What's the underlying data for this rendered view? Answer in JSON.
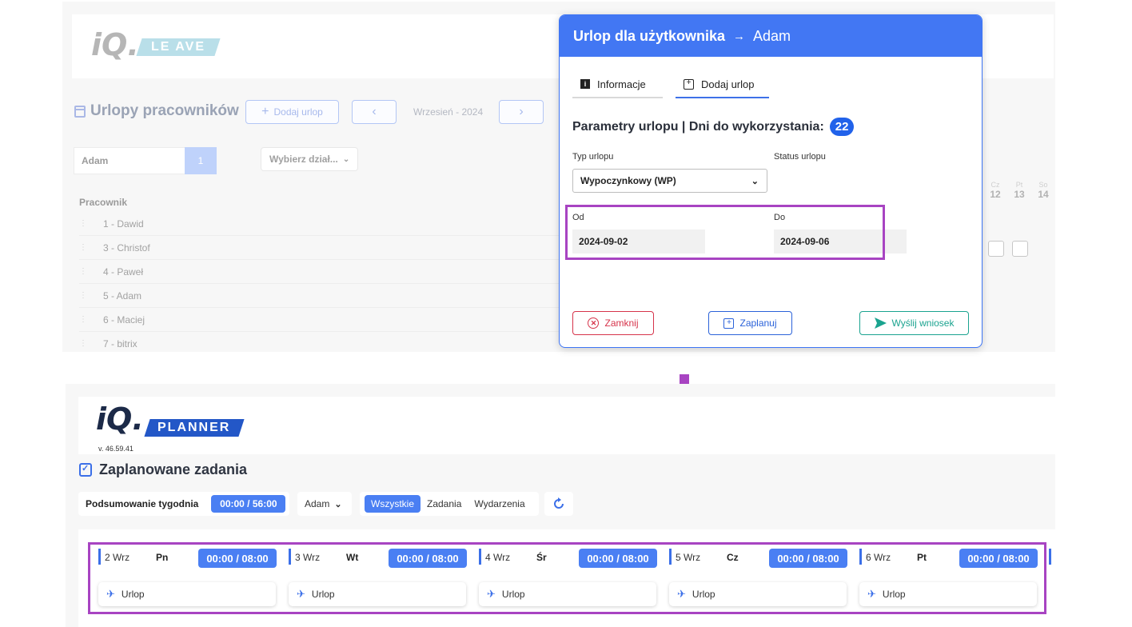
{
  "leave_app": {
    "logo": {
      "iq": "iQ.",
      "tag": "LE AVE"
    },
    "title": "Urlopy pracowników",
    "add_button": "Dodaj urlop",
    "prev_button": "‹",
    "next_button": "›",
    "month": "Wrzesień - 2024",
    "search_value": "Adam",
    "search_count": "1",
    "department_placeholder": "Wybierz dział...",
    "employee_header": "Pracownik",
    "employees": [
      "1 - Dawid",
      "3 - Christof",
      "4 - Paweł",
      "5 - Adam",
      "6 - Maciej",
      "7 - bitrix"
    ],
    "day_headers": [
      {
        "name": "Cz",
        "day": "12"
      },
      {
        "name": "Pt",
        "day": "13"
      },
      {
        "name": "So",
        "day": "14"
      }
    ]
  },
  "modal": {
    "title": "Urlop dla użytkownika",
    "arrow": "→",
    "user": "Adam",
    "tabs": [
      {
        "label": "Informacje",
        "icon": "info-icon"
      },
      {
        "label": "Dodaj urlop",
        "icon": "calendar-plus-icon"
      }
    ],
    "params_title": "Parametry urlopu | Dni do wykorzystania:",
    "days_left": "22",
    "type_label": "Typ urlopu",
    "type_value": "Wypoczynkowy (WP)",
    "status_label": "Status urlopu",
    "from_label": "Od",
    "from_value": "2024-09-02",
    "to_label": "Do",
    "to_value": "2024-09-06",
    "buttons": {
      "close": "Zamknij",
      "plan": "Zaplanuj",
      "send": "Wyślij wniosek"
    },
    "colors": {
      "header": "#4277f3",
      "close": "#d6334a",
      "plan": "#2b62d9",
      "send": "#1aa38f",
      "highlight": "#a844c2"
    }
  },
  "planner_app": {
    "logo": {
      "iq": "iQ.",
      "tag": "PLANNER"
    },
    "version": "v. 46.59.41",
    "title": "Zaplanowane zadania",
    "week_summary_label": "Podsumowanie tygodnia",
    "week_summary_value": "00:00 / 56:00",
    "user_select": "Adam",
    "filters": [
      "Wszystkie",
      "Zadania",
      "Wydarzenia"
    ],
    "days": [
      {
        "date": "2 Wrz",
        "name": "Pn",
        "time": "00:00 / 08:00",
        "task": "Urlop"
      },
      {
        "date": "3 Wrz",
        "name": "Wt",
        "time": "00:00 / 08:00",
        "task": "Urlop"
      },
      {
        "date": "4 Wrz",
        "name": "Śr",
        "time": "00:00 / 08:00",
        "task": "Urlop"
      },
      {
        "date": "5 Wrz",
        "name": "Cz",
        "time": "00:00 / 08:00",
        "task": "Urlop"
      },
      {
        "date": "6 Wrz",
        "name": "Pt",
        "time": "00:00 / 08:00",
        "task": "Urlop"
      }
    ]
  }
}
